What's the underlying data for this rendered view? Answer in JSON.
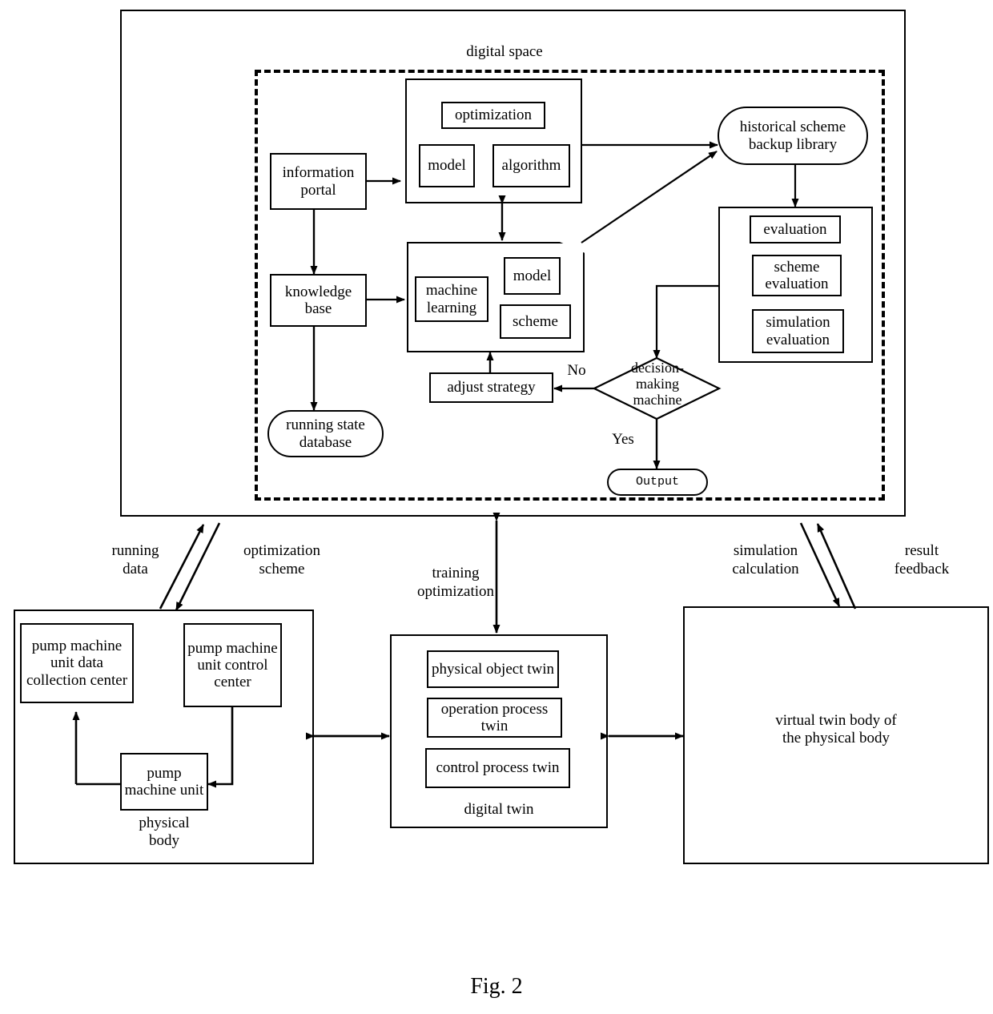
{
  "figure": {
    "caption": "Fig. 2"
  },
  "digital_space": {
    "title": "digital space",
    "information_portal": "information\nportal",
    "knowledge_base": "knowledge\nbase",
    "running_state_database": "running state\ndatabase",
    "optimization_group": {
      "title": "optimization",
      "model": "model",
      "algorithm": "algorithm"
    },
    "learning_group": {
      "machine_learning": "machine\nlearning",
      "model": "model",
      "scheme": "scheme"
    },
    "historical_library": "historical scheme\nbackup library",
    "evaluation_group": {
      "evaluation": "evaluation",
      "scheme_evaluation": "scheme\nevaluation",
      "simulation_evaluation": "simulation\nevaluation"
    },
    "adjust_strategy": "adjust strategy",
    "decision_machine": "decision-\nmaking\nmachine",
    "decision_no_label": "No",
    "decision_yes_label": "Yes",
    "output": "Output"
  },
  "physical_body": {
    "label": "physical\nbody",
    "data_collection_center": "pump machine\nunit data\ncollection\ncenter",
    "control_center": "pump\nmachine unit\ncontrol\ncenter",
    "pump_machine_unit": "pump\nmachine\nunit"
  },
  "digital_twin": {
    "label": "digital twin",
    "physical_object_twin": "physical object\ntwin",
    "operation_process_twin": "operation process\ntwin",
    "control_process_twin": "control process\ntwin"
  },
  "virtual_twin": {
    "label": "virtual twin body of\nthe physical body"
  },
  "edge_labels": {
    "running_data": "running\ndata",
    "optimization_scheme": "optimization\nscheme",
    "training_optimization": "training\noptimization",
    "simulation_calculation": "simulation\ncalculation",
    "result_feedback": "result\nfeedback"
  },
  "colors": {
    "stroke": "#000000",
    "background": "#ffffff"
  }
}
